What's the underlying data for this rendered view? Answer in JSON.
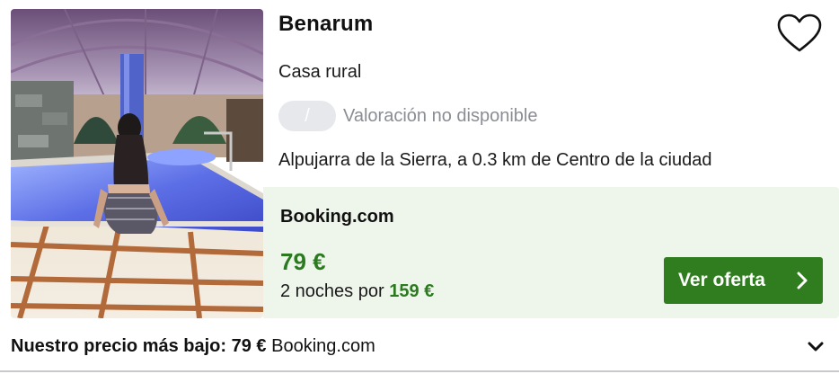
{
  "hotel": {
    "name": "Benarum",
    "type": "Casa rural",
    "rating_value": "/",
    "rating_text": "Valoración no disponible",
    "location": "Alpujarra de la Sierra, a 0.3 km de Centro de la ciudad"
  },
  "deal": {
    "provider": "Booking.com",
    "price": "79 €",
    "nights_prefix": "2 noches por",
    "total": "159 €",
    "cta_label": "Ver oferta"
  },
  "summary": {
    "label": "Nuestro precio más bajo:",
    "price": "79 €",
    "provider": "Booking.com"
  },
  "icons": {
    "favorite": "heart-icon",
    "cta": "chevron-right-icon",
    "expand": "chevron-down-icon"
  },
  "colors": {
    "accent_green": "#2c7a1f",
    "button_green": "#2f7d1e",
    "deal_background": "#eef6ec",
    "rating_pill": "#e6e8ec"
  }
}
